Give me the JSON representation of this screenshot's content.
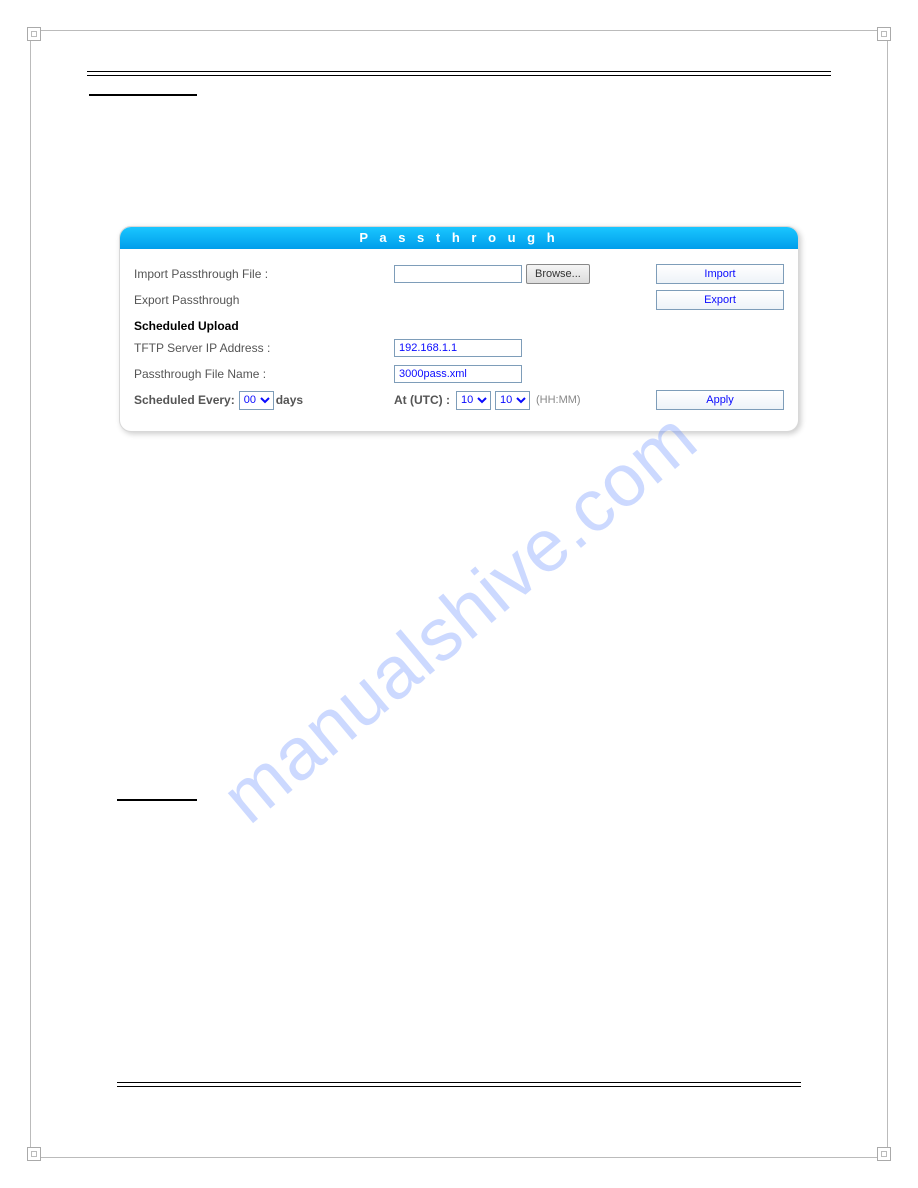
{
  "watermark": "manualshive.com",
  "panel": {
    "title": "P a s s t h r o u g h",
    "importRow": {
      "label": "Import Passthrough File :",
      "browse": "Browse...",
      "button": "Import"
    },
    "exportRow": {
      "label": "Export Passthrough",
      "button": "Export"
    },
    "scheduled": {
      "heading": "Scheduled Upload",
      "tftpLabel": "TFTP Server IP Address :",
      "tftpValue": "192.168.1.1",
      "fileLabel": "Passthrough File Name :",
      "fileValue": "3000pass.xml",
      "everyLabel": "Scheduled Every:",
      "everyValue": "00",
      "everyUnit": "days",
      "atLabel": "At (UTC)  :",
      "hh": "10",
      "mm": "10",
      "timeHint": "(HH:MM)",
      "applyButton": "Apply"
    }
  }
}
